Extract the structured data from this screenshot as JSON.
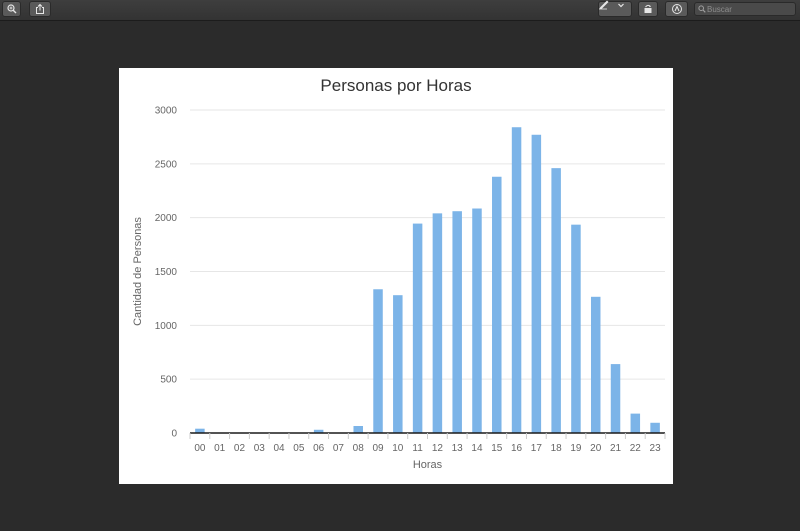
{
  "toolbar": {
    "zoom_icon": "zoom-in-icon",
    "share_icon": "share-icon",
    "markup_icon": "pen-icon",
    "rotate_icon": "rotate-icon",
    "annotate_icon": "markup-circle-icon",
    "search_placeholder": "Buscar"
  },
  "colors": {
    "window_bg": "#2b2b2b",
    "bar": "#7cb4e8",
    "axis": "#1a1a1a",
    "grid": "#e6e6e6",
    "text": "#666666"
  },
  "chart_data": {
    "type": "bar",
    "title": "Personas por Horas",
    "xlabel": "Horas",
    "ylabel": "Cantidad de Personas",
    "ylim": [
      0,
      3000
    ],
    "yticks": [
      "0",
      "500",
      "1000",
      "1500",
      "2000",
      "2500",
      "3000"
    ],
    "grid": true,
    "categories": [
      "00",
      "01",
      "02",
      "03",
      "04",
      "05",
      "06",
      "07",
      "08",
      "09",
      "10",
      "11",
      "12",
      "13",
      "14",
      "15",
      "16",
      "17",
      "18",
      "19",
      "20",
      "21",
      "22",
      "23"
    ],
    "values": [
      40,
      0,
      0,
      0,
      0,
      0,
      30,
      0,
      65,
      1335,
      1280,
      1945,
      2040,
      2060,
      2085,
      2380,
      2840,
      2770,
      2460,
      1935,
      1265,
      640,
      180,
      95
    ]
  }
}
